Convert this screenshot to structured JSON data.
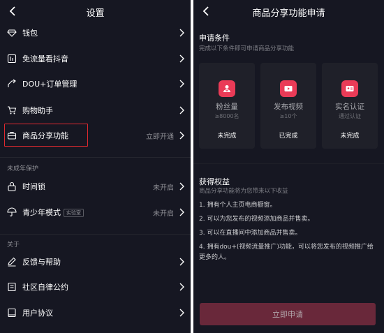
{
  "left": {
    "title": "设置",
    "items": [
      {
        "label": "钱包",
        "value": ""
      },
      {
        "label": "免流量看抖音",
        "value": ""
      },
      {
        "label": "DOU+订单管理",
        "value": ""
      },
      {
        "label": "购物助手",
        "value": ""
      },
      {
        "label": "商品分享功能",
        "value": "立即开通"
      }
    ],
    "section_minor": {
      "title": "未成年保护",
      "items": [
        {
          "label": "时间锁",
          "value": "未开启"
        },
        {
          "label": "青少年模式",
          "badge": "实验室",
          "value": "未开启"
        }
      ]
    },
    "section_about": {
      "title": "关于",
      "items": [
        {
          "label": "反馈与帮助",
          "value": ""
        },
        {
          "label": "社区自律公约",
          "value": ""
        },
        {
          "label": "用户协议",
          "value": ""
        }
      ]
    }
  },
  "right": {
    "title": "商品分享功能申请",
    "conditions": {
      "title": "申请条件",
      "subtitle": "完成以下条件即可申请商品分享功能",
      "cards": [
        {
          "name": "粉丝量",
          "desc": "≥8000名",
          "status": "未完成",
          "icon": "fans-icon"
        },
        {
          "name": "发布视频",
          "desc": "≥10个",
          "status": "已完成",
          "icon": "video-icon"
        },
        {
          "name": "实名认证",
          "desc": "通过认证",
          "status": "未完成",
          "icon": "id-card-icon"
        }
      ]
    },
    "benefits": {
      "title": "获得权益",
      "subtitle": "商品分享功能将为您带来以下收益",
      "items": [
        "1. 拥有个人主页电商橱窗。",
        "2. 可以为您发布的视频添加商品并售卖。",
        "3. 可以在直播间中添加商品并售卖。",
        "4. 拥有dou+(视频流量推广)功能，可以将您发布的视频推广给更多的人。"
      ]
    },
    "apply_button": "立即申请"
  },
  "colors": {
    "background": "#161722",
    "card": "#1f2029",
    "accent": "#ea3b57",
    "highlight": "#e0292f",
    "button": "#69283a"
  }
}
